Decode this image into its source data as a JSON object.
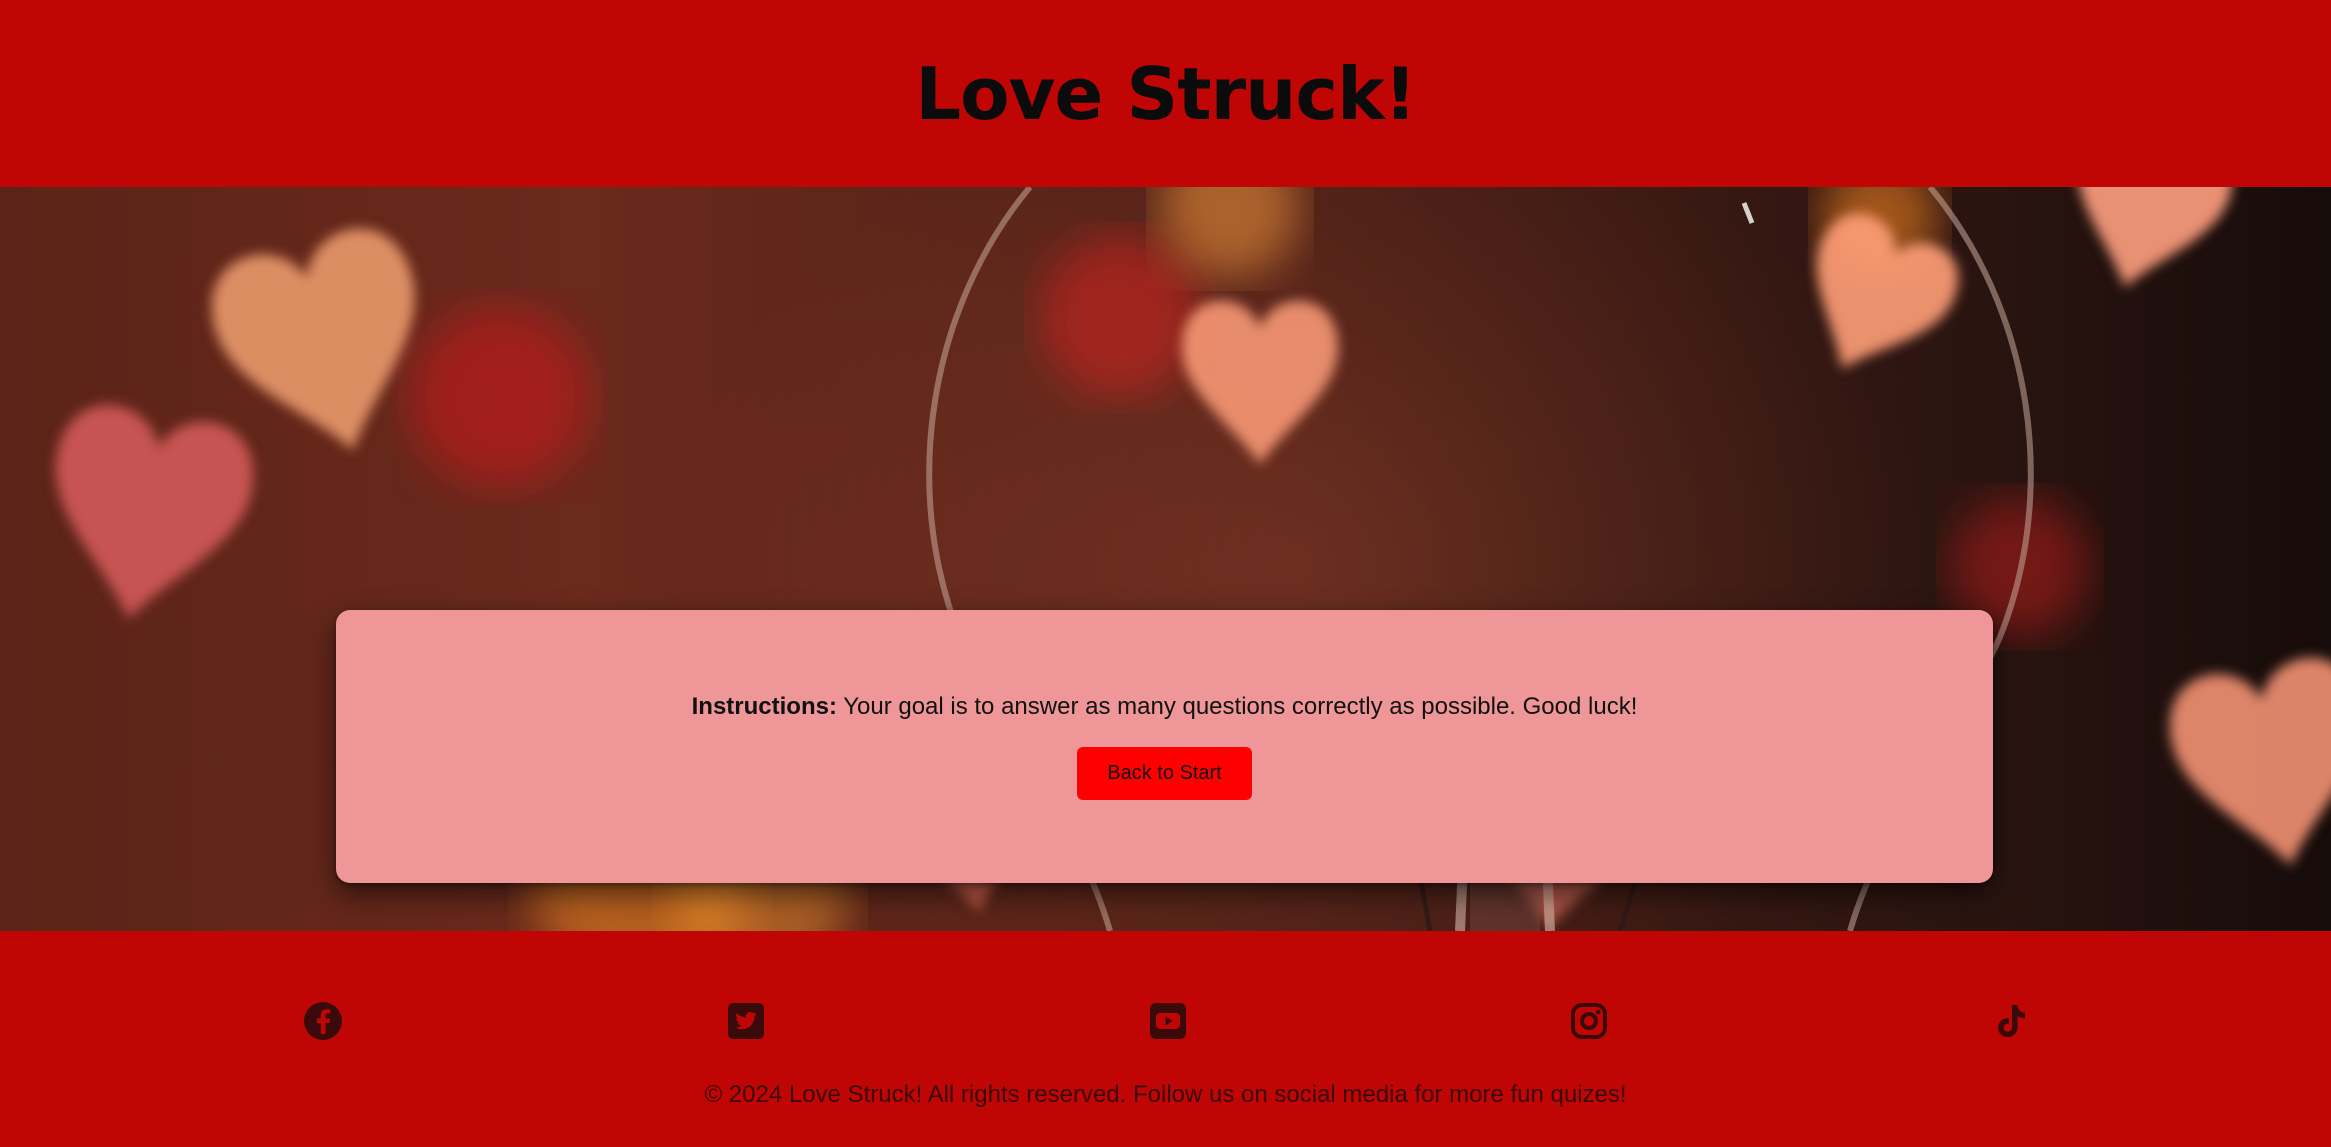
{
  "header": {
    "title": "Love Struck!"
  },
  "instructions": {
    "label": "Instructions:",
    "text": " Your goal is to answer as many questions correctly as possible. Good luck!",
    "back_button_label": "Back to Start"
  },
  "footer": {
    "social_icons": [
      "facebook-icon",
      "twitter-icon",
      "youtube-icon",
      "instagram-icon",
      "tiktok-icon"
    ],
    "copyright": "© 2024 Love Struck! All rights reserved. Follow us on social media for more fun quizes!"
  },
  "colors": {
    "brand_red": "#c00505",
    "card_pink": "#ef9798",
    "button_red": "#ff0000"
  }
}
